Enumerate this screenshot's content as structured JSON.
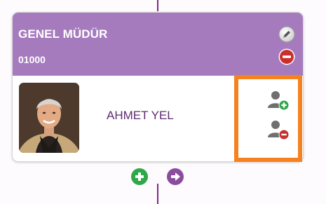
{
  "node": {
    "title": "GENEL MÜDÜR",
    "code": "01000",
    "person_name": "AHMET YEL"
  },
  "icons": {
    "edit": "pencil-icon",
    "delete": "minus-circle-icon",
    "add_user": "user-add-icon",
    "remove_user": "user-remove-icon",
    "add_child": "plus-circle-icon",
    "navigate": "arrow-right-circle-icon"
  },
  "colors": {
    "header": "#a57bbd",
    "connector": "#7b2d7e",
    "name_text": "#5f2d72",
    "highlight": "#f5821f",
    "delete_red": "#c9302c",
    "add_green": "#2ea84a",
    "nav_purple": "#8a4d9e"
  }
}
